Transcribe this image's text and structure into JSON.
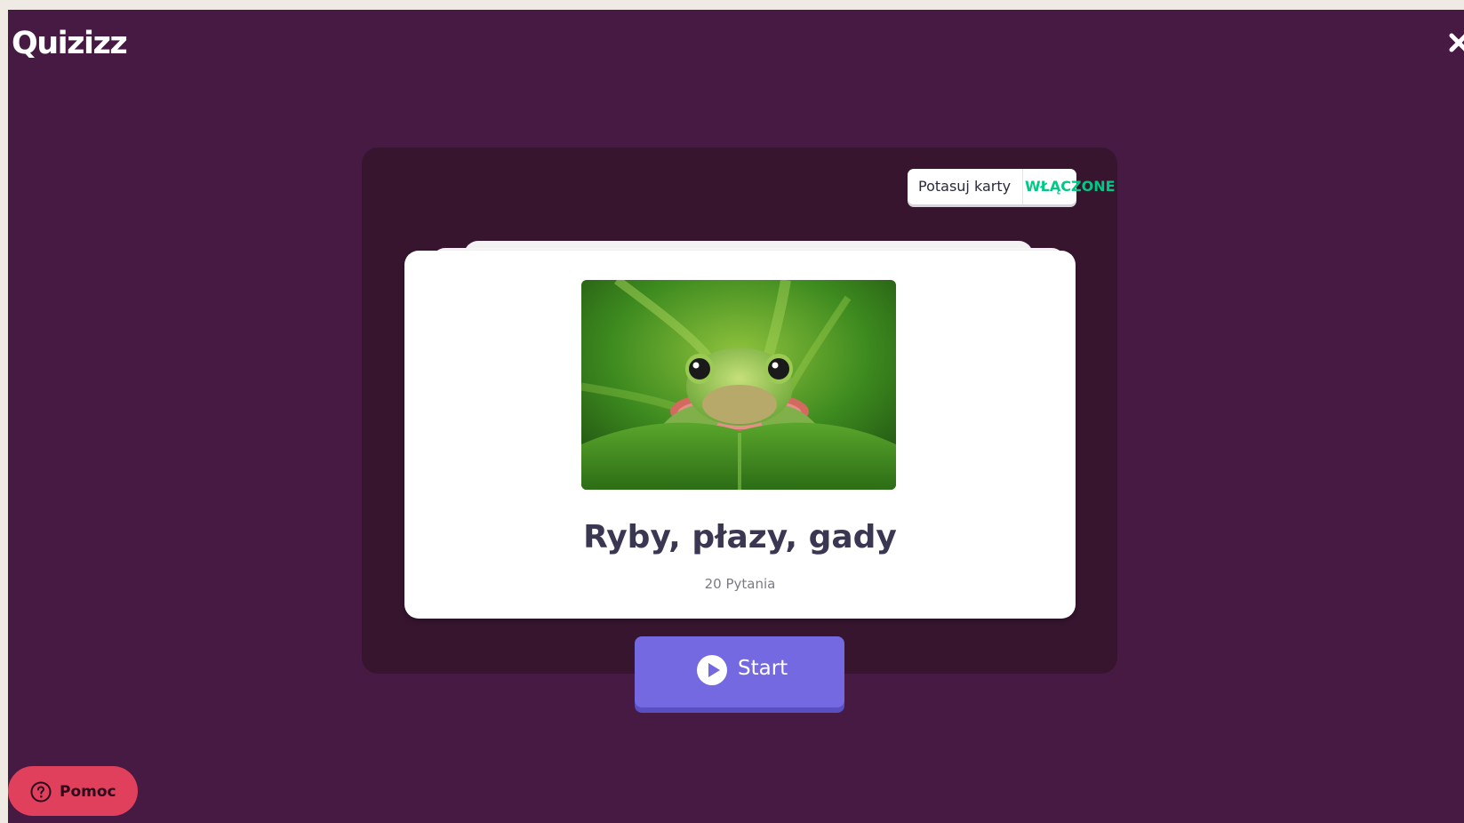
{
  "header": {
    "logo_text": "Quizizz",
    "close_icon": "close-icon"
  },
  "controls": {
    "shuffle_label": "Potasuj karty",
    "shuffle_state": "WŁĄCZONE"
  },
  "card": {
    "image_icon": "frog-image",
    "title": "Ryby, płazy, gady",
    "question_count": "20 Pytania"
  },
  "actions": {
    "start_label": "Start",
    "start_icon": "play-icon"
  },
  "help": {
    "label": "Pomoc",
    "icon": "question-circle-icon"
  },
  "colors": {
    "background": "#461a42",
    "panel": "#37152f",
    "accent_start": "#7469e0",
    "shuffle_on": "#00c985",
    "help_button": "#e0405c"
  }
}
